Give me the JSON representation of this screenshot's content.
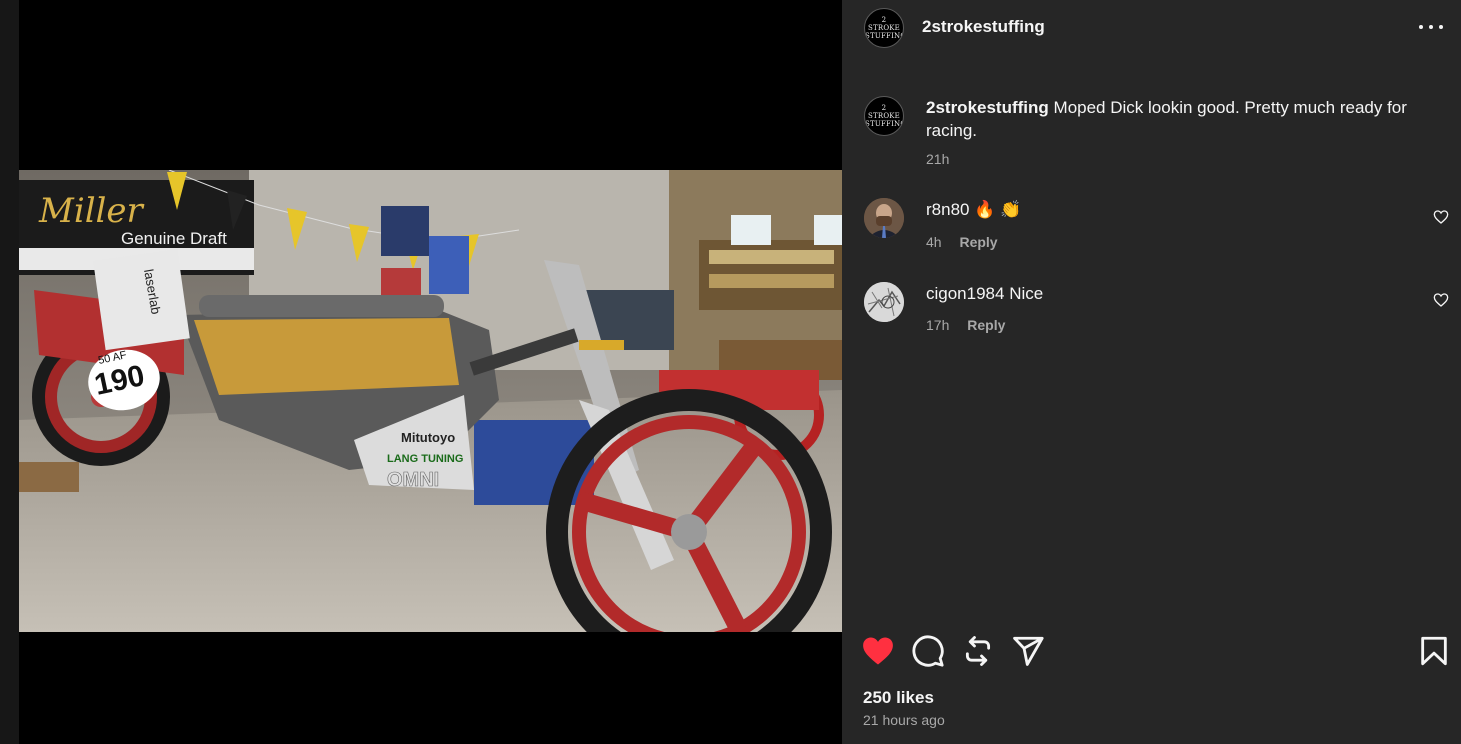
{
  "post": {
    "username": "2strokestuffing",
    "avatar_text": [
      "2 STROKE",
      "STUFFING"
    ],
    "caption": {
      "username": "2strokestuffing",
      "text": "Moped Dick lookin good. Pretty much ready for racing.",
      "time": "21h"
    },
    "photo": {
      "signs": {
        "miller": "Miller",
        "genuine_draft": "Genuine Draft",
        "plate_top": "50 AF",
        "plate_number": "190",
        "mitutoyo": "Mitutoyo",
        "lang_tuning": "LANG TUNING",
        "omni": "OMNI",
        "laserlab": "laserlab"
      }
    },
    "comments": [
      {
        "username": "r8n80",
        "text": "🔥 👏",
        "time": "4h",
        "reply_label": "Reply"
      },
      {
        "username": "cigon1984",
        "text": "Nice",
        "time": "17h",
        "reply_label": "Reply"
      }
    ],
    "actions": {
      "like_icon": "heart-icon",
      "comment_icon": "comment-icon",
      "repost_icon": "repost-icon",
      "share_icon": "share-icon",
      "save_icon": "bookmark-icon",
      "liked_color": "#ff3040"
    },
    "likes_text": "250 likes",
    "posted_ago": "21 hours ago"
  }
}
